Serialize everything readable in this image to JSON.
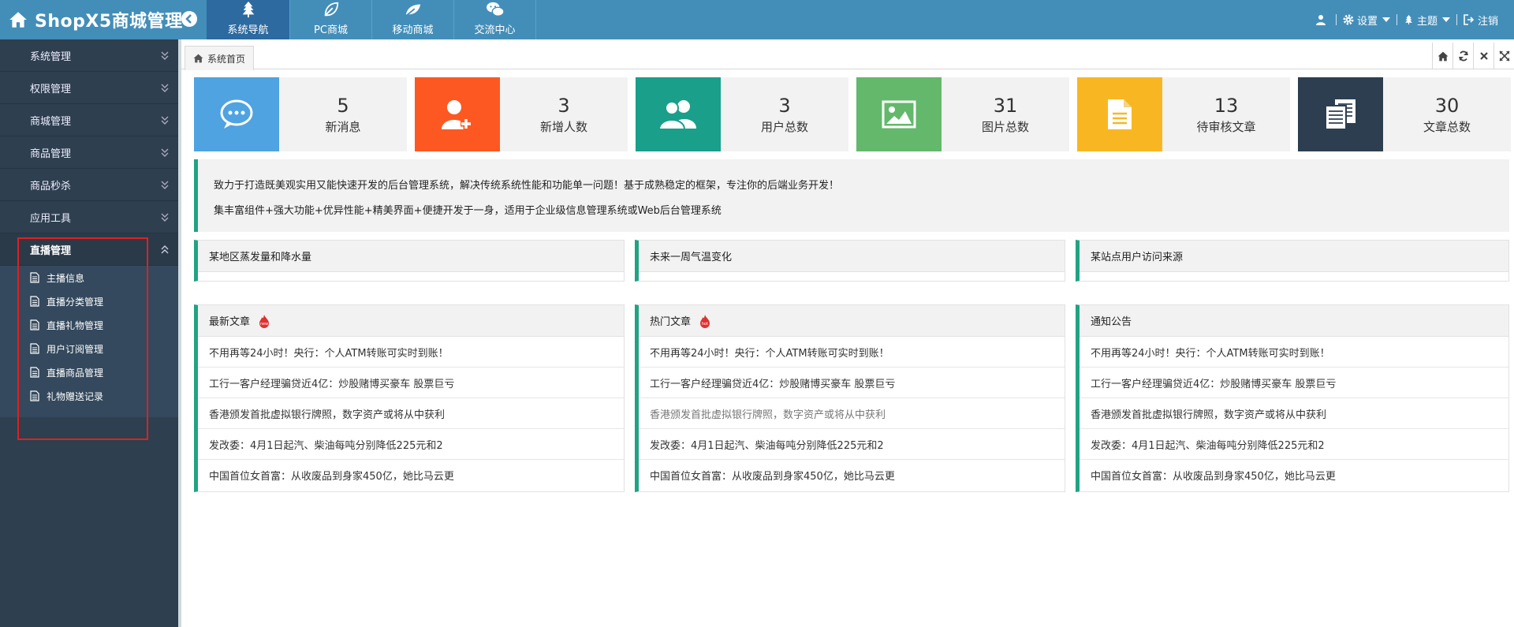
{
  "header": {
    "title": "ShopX5商城管理",
    "nav_tabs": [
      {
        "label": "系统导航",
        "icon": "tree-icon",
        "active": true
      },
      {
        "label": "PC商城",
        "icon": "leaf-icon",
        "active": false
      },
      {
        "label": "移动商城",
        "icon": "leaf-icon",
        "active": false
      },
      {
        "label": "交流中心",
        "icon": "wechat-icon",
        "active": false
      }
    ],
    "right": {
      "settings_label": "设置",
      "theme_label": "主题",
      "logout_label": "注销"
    }
  },
  "sidebar": {
    "items": [
      {
        "label": "系统管理"
      },
      {
        "label": "权限管理"
      },
      {
        "label": "商城管理"
      },
      {
        "label": "商品管理"
      },
      {
        "label": "商品秒杀"
      },
      {
        "label": "应用工具"
      },
      {
        "label": "直播管理"
      }
    ],
    "submenu": [
      {
        "label": "主播信息"
      },
      {
        "label": "直播分类管理"
      },
      {
        "label": "直播礼物管理"
      },
      {
        "label": "用户订阅管理"
      },
      {
        "label": "直播商品管理"
      },
      {
        "label": "礼物赠送记录"
      }
    ]
  },
  "tabbar": {
    "page_tab": "系统首页"
  },
  "stats": [
    {
      "value": "5",
      "label": "新消息",
      "color": "#4fa3e0",
      "icon": "chat-icon"
    },
    {
      "value": "3",
      "label": "新增人数",
      "color": "#fd5822",
      "icon": "user-add-icon"
    },
    {
      "value": "3",
      "label": "用户总数",
      "color": "#1a9f8b",
      "icon": "users-icon"
    },
    {
      "value": "31",
      "label": "图片总数",
      "color": "#63b86b",
      "icon": "picture-icon"
    },
    {
      "value": "13",
      "label": "待审核文章",
      "color": "#f8b722",
      "icon": "document-icon"
    },
    {
      "value": "30",
      "label": "文章总数",
      "color": "#2d3e50",
      "icon": "documents-icon"
    }
  ],
  "intro": {
    "line1": "致力于打造既美观实用又能快速开发的后台管理系统，解决传统系统性能和功能单一问题！基于成熟稳定的框架，专注你的后端业务开发！",
    "line2": "集丰富组件+强大功能+优异性能+精美界面+便捷开发于一身，适用于企业级信息管理系统或Web后台管理系统"
  },
  "chart_panels": [
    {
      "title": "某地区蒸发量和降水量"
    },
    {
      "title": "未来一周气温变化"
    },
    {
      "title": "某站点用户访问来源"
    }
  ],
  "list_panels": [
    {
      "title": "最新文章",
      "hot": true,
      "rows": [
        "不用再等24小时！央行：个人ATM转账可实时到账！",
        "工行一客户经理骗贷近4亿：炒股赌博买豪车 股票巨亏",
        "香港颁发首批虚拟银行牌照，数字资产或将从中获利",
        "发改委：4月1日起汽、柴油每吨分别降低225元和2",
        "中国首位女首富：从收废品到身家450亿，她比马云更"
      ]
    },
    {
      "title": "热门文章",
      "hot": true,
      "rows": [
        "不用再等24小时！央行：个人ATM转账可实时到账！",
        "工行一客户经理骗贷近4亿：炒股赌博买豪车 股票巨亏",
        "香港颁发首批虚拟银行牌照，数字资产或将从中获利",
        "发改委：4月1日起汽、柴油每吨分别降低225元和2",
        "中国首位女首富：从收废品到身家450亿，她比马云更"
      ]
    },
    {
      "title": "通知公告",
      "hot": false,
      "rows": [
        "不用再等24小时！央行：个人ATM转账可实时到账！",
        "工行一客户经理骗贷近4亿：炒股赌博买豪车 股票巨亏",
        "香港颁发首批虚拟银行牌照，数字资产或将从中获利",
        "发改委：4月1日起汽、柴油每吨分别降低225元和2",
        "中国首位女首富：从收废品到身家450亿，她比马云更"
      ]
    }
  ]
}
